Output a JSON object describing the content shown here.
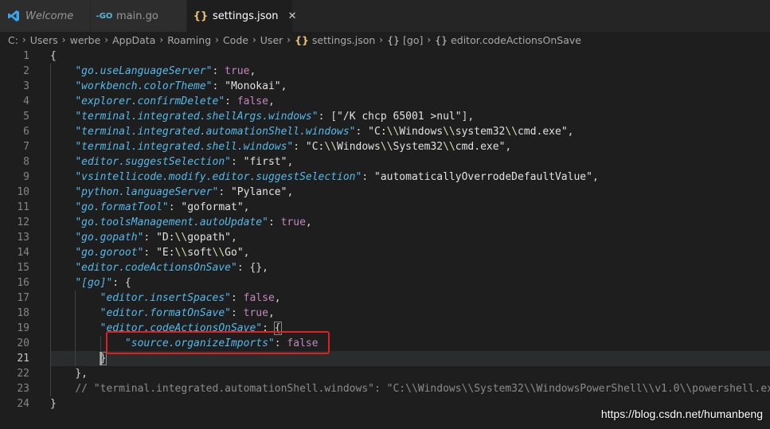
{
  "tabs": [
    {
      "label": "Welcome",
      "icon": "vscode-icon"
    },
    {
      "label": "main.go",
      "icon": "go-icon"
    },
    {
      "label": "settings.json",
      "icon": "json-braces-icon",
      "active": true
    }
  ],
  "breadcrumb": {
    "segments": [
      "C:",
      "Users",
      "werbe",
      "AppData",
      "Roaming",
      "Code",
      "User"
    ],
    "file": "settings.json",
    "file_icon": "{}",
    "obj_icon": "{}",
    "objects": [
      "[go]",
      "editor.codeActionsOnSave"
    ]
  },
  "colors": {
    "key": "#56b9ea",
    "string": "#e1e1e1",
    "boolean": "#c586c0",
    "comment": "#8b8b8b",
    "highlight_box": "#e02020"
  },
  "editor": {
    "current_line": 21,
    "lines": [
      {
        "n": 1,
        "tokens": [
          [
            "p",
            "{"
          ]
        ]
      },
      {
        "n": 2,
        "tokens": [
          [
            "s",
            "    "
          ],
          [
            "k",
            "\"go.useLanguageServer\""
          ],
          [
            "p",
            ": "
          ],
          [
            "b",
            "true"
          ],
          [
            "p",
            ","
          ]
        ]
      },
      {
        "n": 3,
        "tokens": [
          [
            "s",
            "    "
          ],
          [
            "k",
            "\"workbench.colorTheme\""
          ],
          [
            "p",
            ": "
          ],
          [
            "s",
            "\"Monokai\""
          ],
          [
            "p",
            ","
          ]
        ]
      },
      {
        "n": 4,
        "tokens": [
          [
            "s",
            "    "
          ],
          [
            "k",
            "\"explorer.confirmDelete\""
          ],
          [
            "p",
            ": "
          ],
          [
            "b",
            "false"
          ],
          [
            "p",
            ","
          ]
        ]
      },
      {
        "n": 5,
        "tokens": [
          [
            "s",
            "    "
          ],
          [
            "k",
            "\"terminal.integrated.shellArgs.windows\""
          ],
          [
            "p",
            ": ["
          ],
          [
            "s",
            "\"/K chcp 65001 >nul\""
          ],
          [
            "p",
            "],"
          ]
        ]
      },
      {
        "n": 6,
        "tokens": [
          [
            "s",
            "    "
          ],
          [
            "k",
            "\"terminal.integrated.automationShell.windows\""
          ],
          [
            "p",
            ": "
          ],
          [
            "s",
            "\"C:"
          ],
          [
            "esc",
            "\\\\"
          ],
          [
            "s",
            "Windows"
          ],
          [
            "esc",
            "\\\\"
          ],
          [
            "s",
            "system32"
          ],
          [
            "esc",
            "\\\\"
          ],
          [
            "s",
            "cmd.exe\""
          ],
          [
            "p",
            ","
          ]
        ]
      },
      {
        "n": 7,
        "tokens": [
          [
            "s",
            "    "
          ],
          [
            "k",
            "\"terminal.integrated.shell.windows\""
          ],
          [
            "p",
            ": "
          ],
          [
            "s",
            "\"C:"
          ],
          [
            "esc",
            "\\\\"
          ],
          [
            "s",
            "Windows"
          ],
          [
            "esc",
            "\\\\"
          ],
          [
            "s",
            "System32"
          ],
          [
            "esc",
            "\\\\"
          ],
          [
            "s",
            "cmd.exe\""
          ],
          [
            "p",
            ","
          ]
        ]
      },
      {
        "n": 8,
        "tokens": [
          [
            "s",
            "    "
          ],
          [
            "k",
            "\"editor.suggestSelection\""
          ],
          [
            "p",
            ": "
          ],
          [
            "s",
            "\"first\""
          ],
          [
            "p",
            ","
          ]
        ]
      },
      {
        "n": 9,
        "tokens": [
          [
            "s",
            "    "
          ],
          [
            "k",
            "\"vsintellicode.modify.editor.suggestSelection\""
          ],
          [
            "p",
            ": "
          ],
          [
            "s",
            "\"automaticallyOverrodeDefaultValue\""
          ],
          [
            "p",
            ","
          ]
        ]
      },
      {
        "n": 10,
        "tokens": [
          [
            "s",
            "    "
          ],
          [
            "k",
            "\"python.languageServer\""
          ],
          [
            "p",
            ": "
          ],
          [
            "s",
            "\"Pylance\""
          ],
          [
            "p",
            ","
          ]
        ]
      },
      {
        "n": 11,
        "tokens": [
          [
            "s",
            "    "
          ],
          [
            "k",
            "\"go.formatTool\""
          ],
          [
            "p",
            ": "
          ],
          [
            "s",
            "\"goformat\""
          ],
          [
            "p",
            ","
          ]
        ]
      },
      {
        "n": 12,
        "tokens": [
          [
            "s",
            "    "
          ],
          [
            "k",
            "\"go.toolsManagement.autoUpdate\""
          ],
          [
            "p",
            ": "
          ],
          [
            "b",
            "true"
          ],
          [
            "p",
            ","
          ]
        ]
      },
      {
        "n": 13,
        "tokens": [
          [
            "s",
            "    "
          ],
          [
            "k",
            "\"go.gopath\""
          ],
          [
            "p",
            ": "
          ],
          [
            "s",
            "\"D:"
          ],
          [
            "esc",
            "\\\\"
          ],
          [
            "s",
            "gopath\""
          ],
          [
            "p",
            ","
          ]
        ]
      },
      {
        "n": 14,
        "tokens": [
          [
            "s",
            "    "
          ],
          [
            "k",
            "\"go.goroot\""
          ],
          [
            "p",
            ": "
          ],
          [
            "s",
            "\"E:"
          ],
          [
            "esc",
            "\\\\"
          ],
          [
            "s",
            "soft"
          ],
          [
            "esc",
            "\\\\"
          ],
          [
            "s",
            "Go\""
          ],
          [
            "p",
            ","
          ]
        ]
      },
      {
        "n": 15,
        "tokens": [
          [
            "s",
            "    "
          ],
          [
            "k",
            "\"editor.codeActionsOnSave\""
          ],
          [
            "p",
            ": {},"
          ]
        ]
      },
      {
        "n": 16,
        "tokens": [
          [
            "s",
            "    "
          ],
          [
            "k",
            "\"[go]\""
          ],
          [
            "p",
            ": {"
          ]
        ]
      },
      {
        "n": 17,
        "tokens": [
          [
            "s",
            "        "
          ],
          [
            "k",
            "\"editor.insertSpaces\""
          ],
          [
            "p",
            ": "
          ],
          [
            "b",
            "false"
          ],
          [
            "p",
            ","
          ]
        ]
      },
      {
        "n": 18,
        "tokens": [
          [
            "s",
            "        "
          ],
          [
            "k",
            "\"editor.formatOnSave\""
          ],
          [
            "p",
            ": "
          ],
          [
            "b",
            "true"
          ],
          [
            "p",
            ","
          ]
        ]
      },
      {
        "n": 19,
        "tokens": [
          [
            "s",
            "        "
          ],
          [
            "k",
            "\"editor.codeActionsOnSave\""
          ],
          [
            "p",
            ": "
          ],
          [
            "brk",
            "{"
          ]
        ]
      },
      {
        "n": 20,
        "tokens": [
          [
            "s",
            "            "
          ],
          [
            "k",
            "\"source.organizeImports\""
          ],
          [
            "p",
            ": "
          ],
          [
            "b",
            "false"
          ]
        ]
      },
      {
        "n": 21,
        "tokens": [
          [
            "s",
            "        "
          ],
          [
            "brk",
            "}"
          ]
        ]
      },
      {
        "n": 22,
        "tokens": [
          [
            "s",
            "    "
          ],
          [
            "p",
            "},"
          ]
        ]
      },
      {
        "n": 23,
        "tokens": [
          [
            "s",
            "    "
          ],
          [
            "c",
            "// \"terminal.integrated.automationShell.windows\": \"C:\\\\Windows\\\\System32\\\\WindowsPowerShell\\\\v1.0\\\\powershell.exe\""
          ]
        ]
      },
      {
        "n": 24,
        "tokens": [
          [
            "p",
            "}"
          ]
        ]
      }
    ]
  },
  "watermark": "https://blog.csdn.net/humanbeng"
}
